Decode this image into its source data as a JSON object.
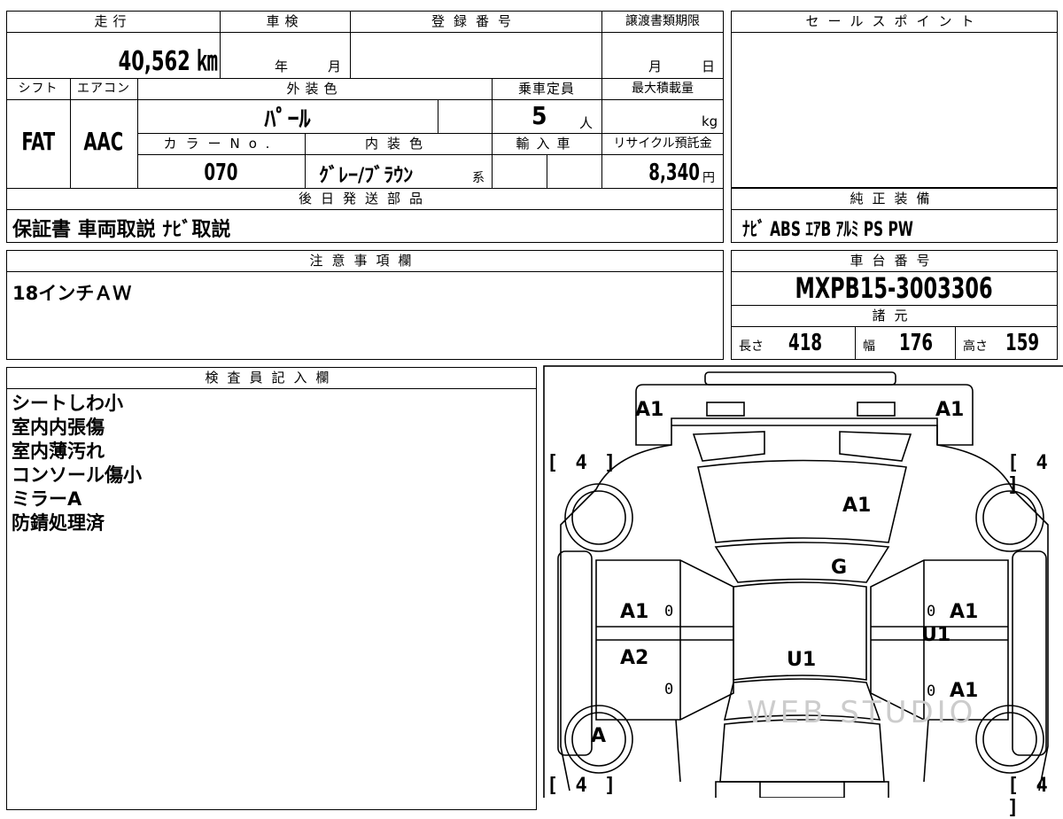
{
  "mileage": {
    "label": "走行",
    "value": "40,562 ㎞"
  },
  "inspection": {
    "label": "車検",
    "year_unit": "年",
    "month_unit": "月"
  },
  "registration": {
    "label": "登録番号",
    "value": ""
  },
  "transfer_deadline": {
    "label": "譲渡書類期限",
    "month_unit": "月",
    "day_unit": "日"
  },
  "sales_point": {
    "label": "セールスポイント",
    "value": ""
  },
  "shift": {
    "label": "シフト",
    "value": "FAT"
  },
  "aircon": {
    "label": "エアコン",
    "value": "AAC"
  },
  "exterior_color": {
    "label": "外装色",
    "value": "ﾊﾟｰﾙ"
  },
  "capacity": {
    "label": "乗車定員",
    "value": "5",
    "unit": "人"
  },
  "max_load": {
    "label": "最大積載量",
    "unit": "kg"
  },
  "color_no": {
    "label": "カラーNo.",
    "value": "070"
  },
  "interior_color": {
    "label": "内装色",
    "value": "ｸﾞﾚｰ/ﾌﾞﾗｳﾝ",
    "suffix": "系"
  },
  "import": {
    "label": "輸入車"
  },
  "recycle": {
    "label": "リサイクル預託金",
    "value": "8,340",
    "unit": "円"
  },
  "later_parts": {
    "label": "後日発送部品",
    "value": "保証書 車両取説 ﾅﾋﾞ取説"
  },
  "genuine_equipment": {
    "label": "純正装備",
    "value": "ﾅﾋﾞ ABS ｴｱB ｱﾙﾐ PS PW"
  },
  "caution": {
    "label": "注意事項欄",
    "value": "18インチＡＷ"
  },
  "chassis": {
    "label": "車台番号",
    "value": "MXPB15-3003306"
  },
  "specs": {
    "label": "諸元",
    "length_label": "長さ",
    "length": "418",
    "width_label": "幅",
    "width": "176",
    "height_label": "高さ",
    "height": "159"
  },
  "inspector": {
    "label": "検査員記入欄",
    "notes": [
      "シートしわ小",
      "室内内張傷",
      "室内薄汚れ",
      "コンソール傷小",
      "ミラーA",
      "防錆処理済"
    ]
  },
  "diagram": {
    "marks": {
      "a1_front_left": "A1",
      "a1_front_right": "A1",
      "a1_hood": "A1",
      "g_windshield": "G",
      "a1_left_front_door": "A1",
      "a2_left_rear_door": "A2",
      "u1_roof": "U1",
      "a1_right_front_door": "A1",
      "u1_right": "U1",
      "a1_right_rear_door": "A1",
      "a_left_rear_wheel": "A"
    },
    "tire_tl": "[ 4 ]",
    "tire_tr": "[ 4 ]",
    "tire_bl": "[ 4 ]",
    "tire_br": "[ 4 ]",
    "zero": "0",
    "watermark": "WEB STUDIO"
  }
}
